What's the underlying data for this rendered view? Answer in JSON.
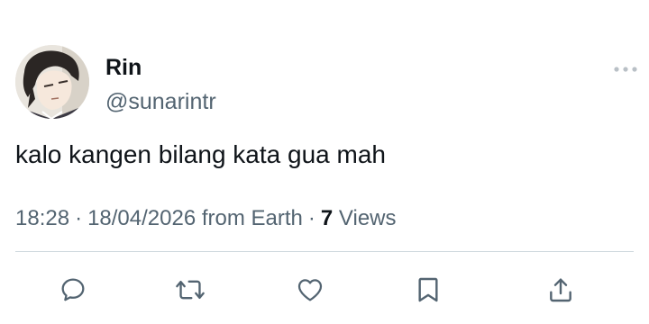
{
  "user": {
    "display_name": "Rin",
    "handle": "@sunarintr",
    "avatar_icon": "anime-character-avatar"
  },
  "more_icon": "more-horizontal-icon",
  "tweet": {
    "text": "kalo kangen bilang kata gua mah"
  },
  "meta": {
    "time": "18:28",
    "separator": "·",
    "date": "18/04/2026",
    "source": "from Earth",
    "views_count": "7",
    "views_label": "Views"
  },
  "actions": [
    {
      "name": "reply",
      "icon": "reply-icon"
    },
    {
      "name": "retweet",
      "icon": "retweet-icon"
    },
    {
      "name": "like",
      "icon": "heart-icon"
    },
    {
      "name": "bookmark",
      "icon": "bookmark-icon"
    },
    {
      "name": "share",
      "icon": "share-icon"
    }
  ],
  "colors": {
    "primary_text": "#0f1419",
    "secondary_text": "#536471",
    "divider": "#cfd9de"
  }
}
